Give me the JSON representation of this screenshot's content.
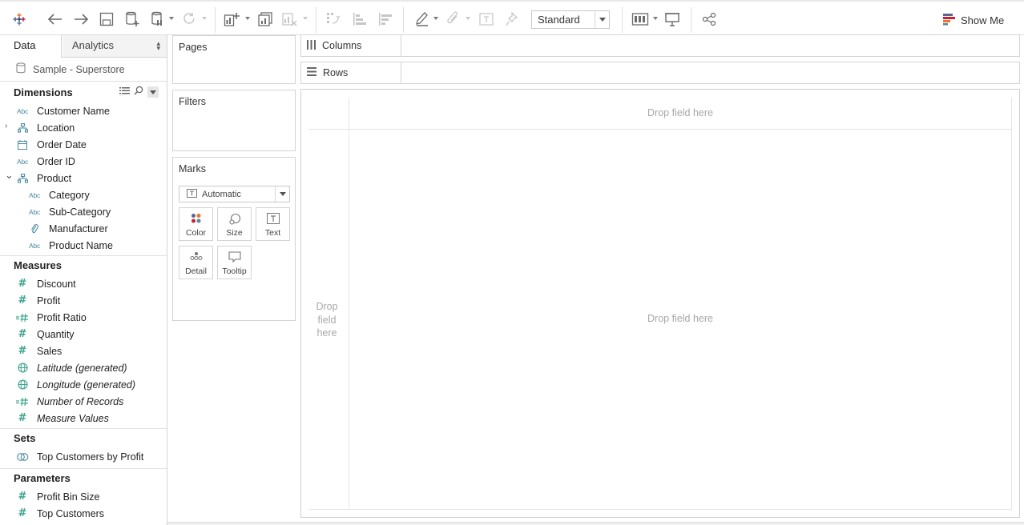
{
  "toolbar": {
    "fit_value": "Standard",
    "show_me_label": "Show Me",
    "icons": [
      "tableau-logo-icon",
      "undo-icon",
      "redo-icon",
      "save-icon",
      "new-data-source-icon",
      "pause-auto-update-icon",
      "refresh-icon",
      "new-worksheet-icon",
      "duplicate-sheet-icon",
      "clear-sheet-icon",
      "swap-icon",
      "sort-ascending-icon",
      "sort-descending-icon",
      "highlight-icon",
      "group-icon",
      "show-labels-icon",
      "fix-axes-icon",
      "show-cards-icon",
      "presentation-icon",
      "share-icon",
      "show-me-icon"
    ]
  },
  "data_pane": {
    "tab_data": "Data",
    "tab_analytics": "Analytics",
    "data_source": "Sample - Superstore",
    "dimensions_header": "Dimensions",
    "dimensions": [
      {
        "label": "Customer Name",
        "icon": "abc"
      },
      {
        "label": "Location",
        "icon": "hierarchy"
      },
      {
        "label": "Order Date",
        "icon": "calendar"
      },
      {
        "label": "Order ID",
        "icon": "abc"
      },
      {
        "label": "Product",
        "icon": "hierarchy"
      },
      {
        "label": "Category",
        "icon": "abc"
      },
      {
        "label": "Sub-Category",
        "icon": "abc"
      },
      {
        "label": "Manufacturer",
        "icon": "paperclip"
      },
      {
        "label": "Product Name",
        "icon": "abc"
      }
    ],
    "measures_header": "Measures",
    "measures": [
      {
        "label": "Discount",
        "icon": "hash"
      },
      {
        "label": "Profit",
        "icon": "hash"
      },
      {
        "label": "Profit Ratio",
        "icon": "calc-hash"
      },
      {
        "label": "Quantity",
        "icon": "hash"
      },
      {
        "label": "Sales",
        "icon": "hash"
      },
      {
        "label": "Latitude (generated)",
        "icon": "globe"
      },
      {
        "label": "Longitude (generated)",
        "icon": "globe"
      },
      {
        "label": "Number of Records",
        "icon": "calc-hash"
      },
      {
        "label": "Measure Values",
        "icon": "hash"
      }
    ],
    "sets_header": "Sets",
    "sets": [
      {
        "label": "Top Customers by Profit",
        "icon": "set"
      }
    ],
    "parameters_header": "Parameters",
    "parameters": [
      {
        "label": "Profit Bin Size",
        "icon": "hash"
      },
      {
        "label": "Top Customers",
        "icon": "hash"
      }
    ]
  },
  "cards": {
    "pages": "Pages",
    "filters": "Filters",
    "marks": "Marks",
    "mark_type": "Automatic",
    "mark_buttons": [
      "Color",
      "Size",
      "Text",
      "Detail",
      "Tooltip"
    ]
  },
  "shelves": {
    "columns": "Columns",
    "rows": "Rows"
  },
  "view": {
    "drop_top": "Drop field here",
    "drop_center": "Drop field here",
    "drop_left_1": "Drop",
    "drop_left_2": "field",
    "drop_left_3": "here"
  }
}
